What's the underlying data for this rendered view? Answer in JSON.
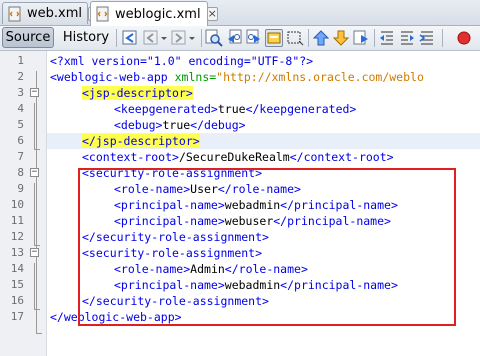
{
  "tabs": [
    {
      "label": "web.xml",
      "close_glyph": "×",
      "active": false
    },
    {
      "label": "weblogic.xml",
      "close_glyph": "×",
      "active": true
    }
  ],
  "toolbar": {
    "source_label": "Source",
    "history_label": "History",
    "icons": [
      "last-edit-icon",
      "back-icon",
      "dropdown-arrow-icon",
      "forward-icon",
      "dropdown-arrow-icon",
      "find-icon",
      "find-previous-icon",
      "find-next-icon",
      "toggle-highlight-icon",
      "toggle-rect-select-icon",
      "previous-bookmark-icon",
      "next-bookmark-icon",
      "toggle-bookmark-icon",
      "shift-left-icon",
      "shift-right-icon",
      "record-macro-icon"
    ]
  },
  "editor": {
    "lines": [
      {
        "n": "1",
        "fold": ""
      },
      {
        "n": "2",
        "fold": ""
      },
      {
        "n": "3",
        "fold": "−"
      },
      {
        "n": "4",
        "fold": ""
      },
      {
        "n": "5",
        "fold": ""
      },
      {
        "n": "6",
        "fold": ""
      },
      {
        "n": "7",
        "fold": ""
      },
      {
        "n": "8",
        "fold": "−"
      },
      {
        "n": "9",
        "fold": ""
      },
      {
        "n": "10",
        "fold": ""
      },
      {
        "n": "11",
        "fold": ""
      },
      {
        "n": "12",
        "fold": ""
      },
      {
        "n": "13",
        "fold": "−"
      },
      {
        "n": "14",
        "fold": ""
      },
      {
        "n": "15",
        "fold": ""
      },
      {
        "n": "16",
        "fold": ""
      },
      {
        "n": "17",
        "fold": ""
      }
    ],
    "code": {
      "l1": "<?xml version=\"1.0\" encoding=\"UTF-8\"?>",
      "l2_tag": "<weblogic-web-app",
      "l2_attr": " xmlns=",
      "l2_val": "\"http://xmlns.oracle.com/weblo",
      "l3": "<jsp-descriptor>",
      "l4_open": "<keepgenerated>",
      "l4_text": "true",
      "l4_close": "</keepgenerated>",
      "l5_open": "<debug>",
      "l5_text": "true",
      "l5_close": "</debug>",
      "l6": "</jsp-descriptor>",
      "l7_open": "<context-root>",
      "l7_text": "/SecureDukeRealm",
      "l7_close": "</context-root>",
      "l8": "<security-role-assignment>",
      "l9_open": "<role-name>",
      "l9_text": "User",
      "l9_close": "</role-name>",
      "l10_open": "<principal-name>",
      "l10_text": "webadmin",
      "l10_close": "</principal-name>",
      "l11_open": "<principal-name>",
      "l11_text": "webuser",
      "l11_close": "</principal-name>",
      "l12": "</security-role-assignment>",
      "l13": "<security-role-assignment>",
      "l14_open": "<role-name>",
      "l14_text": "Admin",
      "l14_close": "</role-name>",
      "l15_open": "<principal-name>",
      "l15_text": "webadmin",
      "l15_close": "</principal-name>",
      "l16": "</security-role-assignment>",
      "l17": "</weblogic-web-app>"
    }
  },
  "colors": {
    "tag": "#0000e6",
    "attribute": "#009900",
    "value": "#ce7b00",
    "highlight": "#ffff4d",
    "annotation_box": "#e02020"
  }
}
